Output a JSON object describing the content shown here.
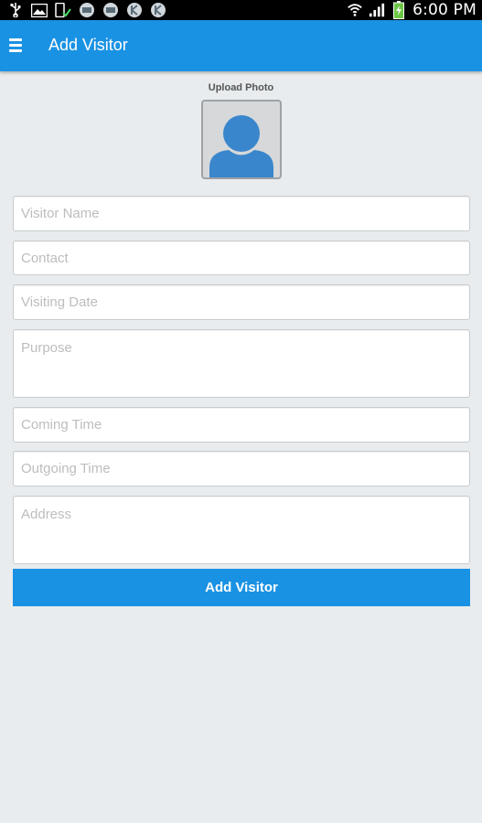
{
  "status_bar": {
    "time": "6:00 PM",
    "left_icons": [
      "usb-icon",
      "image-icon",
      "phone-check-icon",
      "badge-icon",
      "badge-icon",
      "badge-icon",
      "badge-icon"
    ],
    "right_icons": [
      "wifi-icon",
      "signal-icon",
      "battery-icon"
    ]
  },
  "app_bar": {
    "title": "Add Visitor",
    "menu_icon": "hamburger-menu-icon",
    "color": "#1a92e3"
  },
  "photo": {
    "label": "Upload Photo",
    "icon": "user-silhouette-icon"
  },
  "form": {
    "visitor_name": {
      "placeholder": "Visitor Name",
      "value": ""
    },
    "contact": {
      "placeholder": "Contact",
      "value": ""
    },
    "visiting_date": {
      "placeholder": "Visiting Date",
      "value": ""
    },
    "purpose": {
      "placeholder": "Purpose",
      "value": ""
    },
    "coming_time": {
      "placeholder": "Coming Time",
      "value": ""
    },
    "outgoing_time": {
      "placeholder": "Outgoing Time",
      "value": ""
    },
    "address": {
      "placeholder": "Address",
      "value": ""
    }
  },
  "submit": {
    "label": "Add Visitor"
  }
}
